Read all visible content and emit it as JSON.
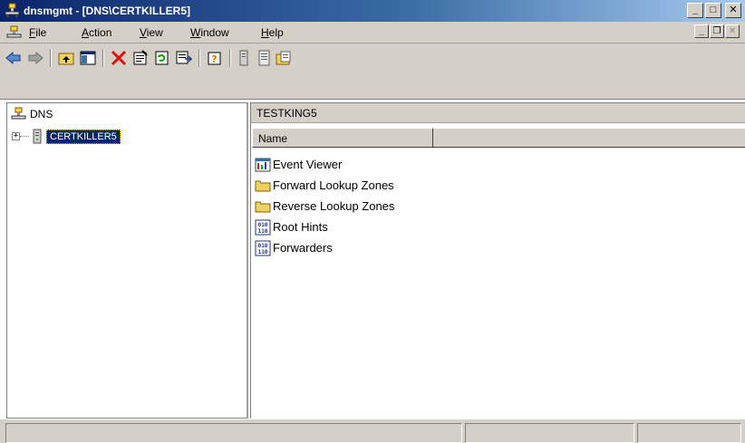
{
  "window": {
    "title": "dnsmgmt - [DNS\\CERTKILLER5]",
    "buttons": {
      "minimize": "_",
      "maximize": "□",
      "close": "✕"
    }
  },
  "menubar": {
    "items": [
      "File",
      "Action",
      "View",
      "Window",
      "Help"
    ],
    "child_buttons": {
      "minimize": "_",
      "restore": "❐",
      "close": "✕"
    }
  },
  "toolbar": {
    "icons": [
      "back-arrow-icon",
      "forward-arrow-icon",
      "up-folder-icon",
      "show-hide-console-tree-icon",
      "delete-icon",
      "properties-icon",
      "refresh-icon",
      "export-list-icon",
      "help-icon",
      "server-icon",
      "zone-icon",
      "new-folder-icon"
    ]
  },
  "tree": {
    "root_label": "DNS",
    "child_label": "CERTKILLER5",
    "expander": "+"
  },
  "details": {
    "header": "TESTKING5",
    "column_name": "Name",
    "items": [
      {
        "label": "Event Viewer",
        "icon": "event-viewer-icon"
      },
      {
        "label": "Forward Lookup Zones",
        "icon": "folder-icon"
      },
      {
        "label": "Reverse Lookup Zones",
        "icon": "folder-icon"
      },
      {
        "label": "Root Hints",
        "icon": "root-hints-icon"
      },
      {
        "label": "Forwarders",
        "icon": "forwarders-icon"
      }
    ]
  },
  "colors": {
    "titlebar_start": "#0a246a",
    "titlebar_end": "#a6caf0",
    "selection": "#0a246a",
    "chrome": "#d4d0c8"
  }
}
